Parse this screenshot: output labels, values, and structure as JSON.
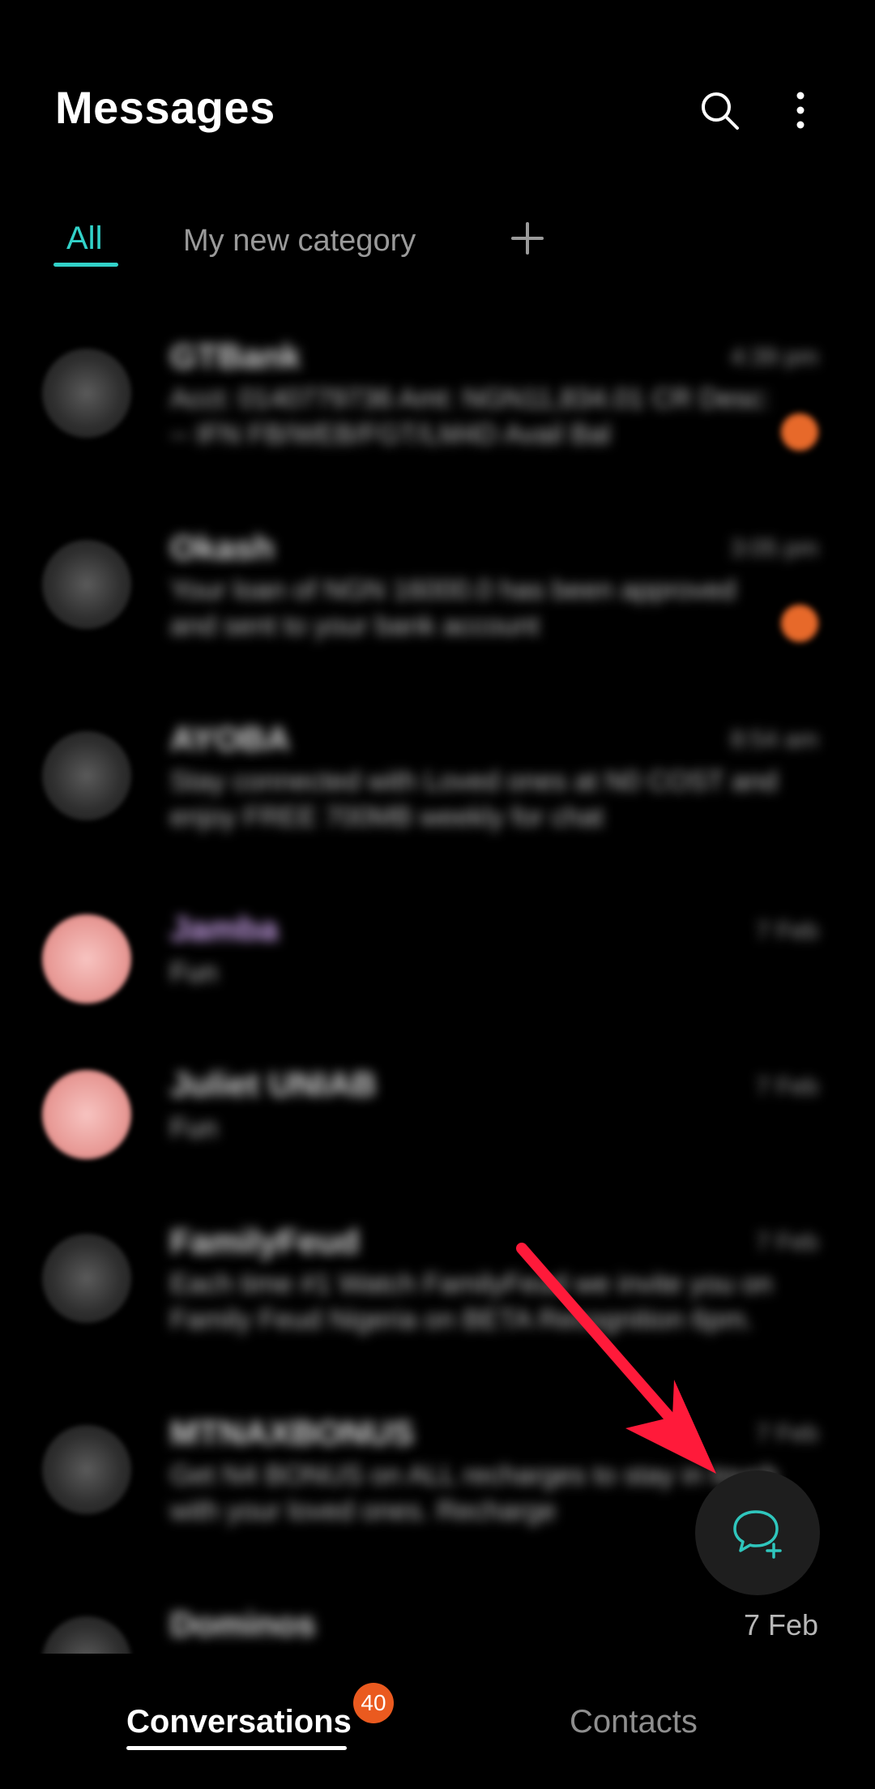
{
  "header": {
    "title": "Messages",
    "search_icon": "search-icon",
    "more_icon": "more-vertical-icon"
  },
  "tabs": [
    {
      "label": "All",
      "active": true
    },
    {
      "label": "My new category",
      "active": false
    }
  ],
  "add_category_icon": "plus-icon",
  "conversations": [
    {
      "name": "GTBank",
      "time": "4:39 pm",
      "preview": "Acct: 0140779736 Amt: NGN11,834.01 CR Desc: -- IFN FB/WEB/FGT/LM4D Avail Bal",
      "unread": true,
      "avatar_color": "#3a3a3a"
    },
    {
      "name": "Okash",
      "time": "3:05 pm",
      "preview": "Your loan of NGN 16000.0 has been approved and sent to your bank account",
      "unread": true,
      "avatar_color": "#3a3a3a"
    },
    {
      "name": "AYOBA",
      "time": "8:54 am",
      "preview": "Stay connected with Loved ones at N0 COST and enjoy FREE 700MB weekly for chat",
      "unread": false,
      "avatar_color": "#3a3a3a"
    },
    {
      "name": "Jamba",
      "time": "7 Feb",
      "preview": "Fun",
      "unread": false,
      "avatar_color": "#f0a9a5"
    },
    {
      "name": "Juliet UNIAB",
      "time": "7 Feb",
      "preview": "Fun",
      "unread": false,
      "avatar_color": "#f0a9a5"
    },
    {
      "name": "FamilyFeud",
      "time": "7 Feb",
      "preview": "Each time #1 Watch FamilyFeud we invite you on Family Feud Nigeria on BETA Recognition 6pm.",
      "unread": false,
      "avatar_color": "#3a3a3a"
    },
    {
      "name": "MTNAXBONUS",
      "time": "7 Feb",
      "preview": "Get N4 BONUS on ALL recharges to stay in touch with your loved ones. Recharge",
      "unread": false,
      "avatar_color": "#3a3a3a"
    },
    {
      "name": "Dominos",
      "time": "",
      "preview": "",
      "unread": false,
      "avatar_color": "#3a3a3a"
    }
  ],
  "fab": {
    "icon": "new-message-icon",
    "date_label": "7 Feb"
  },
  "bottom_nav": {
    "conversations_label": "Conversations",
    "conversations_badge": "40",
    "contacts_label": "Contacts"
  },
  "colors": {
    "accent": "#32d2c9",
    "badge": "#ea5a1f",
    "annotation_arrow": "#ff1a3a"
  }
}
